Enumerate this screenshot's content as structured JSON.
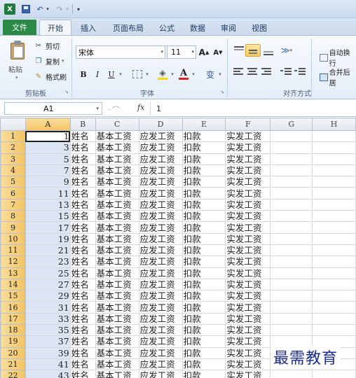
{
  "quick_access": {
    "logo_label": "X",
    "undo_glyph": "↶",
    "redo_glyph": "↷",
    "dropdown_glyph": "▾",
    "customize_glyph": "▾"
  },
  "tabs": {
    "file": "文件",
    "items": [
      "开始",
      "插入",
      "页面布局",
      "公式",
      "数据",
      "审阅",
      "视图"
    ],
    "active_index": 0
  },
  "clipboard": {
    "paste": "粘贴",
    "cut": "剪切",
    "copy": "复制",
    "format_painter": "格式刷",
    "group_label": "剪贴板"
  },
  "font": {
    "name": "宋体",
    "size": "11",
    "grow": "A",
    "shrink": "A",
    "bold": "B",
    "italic": "I",
    "underline": "U",
    "font_color": "A",
    "wen": "变",
    "group_label": "字体"
  },
  "alignment": {
    "wrap_text": "自动换行",
    "merge_center": "合并后居",
    "group_label": "对齐方式"
  },
  "formula_bar": {
    "cell_ref": "A1",
    "fx": "fx",
    "value": "1"
  },
  "sheet": {
    "columns": [
      "A",
      "B",
      "C",
      "D",
      "E",
      "F",
      "G",
      "H"
    ],
    "rows": [
      {
        "n": "1",
        "a": "1",
        "b": "姓名",
        "c": "基本工资",
        "d": "应发工资",
        "e": "扣款",
        "f": "实发工资"
      },
      {
        "n": "2",
        "a": "3",
        "b": "姓名",
        "c": "基本工资",
        "d": "应发工资",
        "e": "扣款",
        "f": "实发工资"
      },
      {
        "n": "3",
        "a": "5",
        "b": "姓名",
        "c": "基本工资",
        "d": "应发工资",
        "e": "扣款",
        "f": "实发工资"
      },
      {
        "n": "4",
        "a": "7",
        "b": "姓名",
        "c": "基本工资",
        "d": "应发工资",
        "e": "扣款",
        "f": "实发工资"
      },
      {
        "n": "5",
        "a": "9",
        "b": "姓名",
        "c": "基本工资",
        "d": "应发工资",
        "e": "扣款",
        "f": "实发工资"
      },
      {
        "n": "6",
        "a": "11",
        "b": "姓名",
        "c": "基本工资",
        "d": "应发工资",
        "e": "扣款",
        "f": "实发工资"
      },
      {
        "n": "7",
        "a": "13",
        "b": "姓名",
        "c": "基本工资",
        "d": "应发工资",
        "e": "扣款",
        "f": "实发工资"
      },
      {
        "n": "8",
        "a": "15",
        "b": "姓名",
        "c": "基本工资",
        "d": "应发工资",
        "e": "扣款",
        "f": "实发工资"
      },
      {
        "n": "9",
        "a": "17",
        "b": "姓名",
        "c": "基本工资",
        "d": "应发工资",
        "e": "扣款",
        "f": "实发工资"
      },
      {
        "n": "10",
        "a": "19",
        "b": "姓名",
        "c": "基本工资",
        "d": "应发工资",
        "e": "扣款",
        "f": "实发工资"
      },
      {
        "n": "11",
        "a": "21",
        "b": "姓名",
        "c": "基本工资",
        "d": "应发工资",
        "e": "扣款",
        "f": "实发工资"
      },
      {
        "n": "12",
        "a": "23",
        "b": "姓名",
        "c": "基本工资",
        "d": "应发工资",
        "e": "扣款",
        "f": "实发工资"
      },
      {
        "n": "13",
        "a": "25",
        "b": "姓名",
        "c": "基本工资",
        "d": "应发工资",
        "e": "扣款",
        "f": "实发工资"
      },
      {
        "n": "14",
        "a": "27",
        "b": "姓名",
        "c": "基本工资",
        "d": "应发工资",
        "e": "扣款",
        "f": "实发工资"
      },
      {
        "n": "15",
        "a": "29",
        "b": "姓名",
        "c": "基本工资",
        "d": "应发工资",
        "e": "扣款",
        "f": "实发工资"
      },
      {
        "n": "16",
        "a": "31",
        "b": "姓名",
        "c": "基本工资",
        "d": "应发工资",
        "e": "扣款",
        "f": "实发工资"
      },
      {
        "n": "17",
        "a": "33",
        "b": "姓名",
        "c": "基本工资",
        "d": "应发工资",
        "e": "扣款",
        "f": "实发工资"
      },
      {
        "n": "18",
        "a": "35",
        "b": "姓名",
        "c": "基本工资",
        "d": "应发工资",
        "e": "扣款",
        "f": "实发工资"
      },
      {
        "n": "19",
        "a": "37",
        "b": "姓名",
        "c": "基本工资",
        "d": "应发工资",
        "e": "扣款",
        "f": "实发工资"
      },
      {
        "n": "20",
        "a": "39",
        "b": "姓名",
        "c": "基本工资",
        "d": "应发工资",
        "e": "扣款",
        "f": "实发工资"
      },
      {
        "n": "21",
        "a": "41",
        "b": "姓名",
        "c": "基本工资",
        "d": "应发工资",
        "e": "扣款",
        "f": "实发工资"
      },
      {
        "n": "22",
        "a": "43",
        "b": "姓名",
        "c": "基本工资",
        "d": "应发工资",
        "e": "扣款",
        "f": "实发工资"
      }
    ],
    "selected_column": "A"
  },
  "watermark": "最需教育",
  "colors": {
    "file_tab": "#2a8a45",
    "selection": "#dbe5f4",
    "header_selected": "#f3c363"
  }
}
